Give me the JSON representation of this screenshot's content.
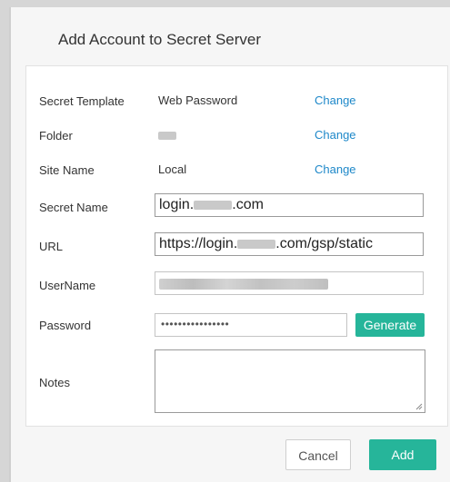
{
  "dialog": {
    "title": "Add Account to Secret Server"
  },
  "form": {
    "secret_template": {
      "label": "Secret Template",
      "value": "Web Password",
      "action": "Change"
    },
    "folder": {
      "label": "Folder",
      "value": "",
      "action": "Change"
    },
    "site_name": {
      "label": "Site Name",
      "value": "Local",
      "action": "Change"
    },
    "secret_name": {
      "label": "Secret Name",
      "prefix": "login.",
      "suffix": ".com"
    },
    "url": {
      "label": "URL",
      "prefix": "https://login.",
      "suffix": ".com/gsp/static"
    },
    "username": {
      "label": "UserName"
    },
    "password": {
      "label": "Password",
      "masked": "••••••••••••••••",
      "generate_label": "Generate"
    },
    "notes": {
      "label": "Notes"
    }
  },
  "footer": {
    "cancel_label": "Cancel",
    "add_label": "Add"
  },
  "colors": {
    "accent": "#26b59a",
    "link": "#1e88c9"
  }
}
